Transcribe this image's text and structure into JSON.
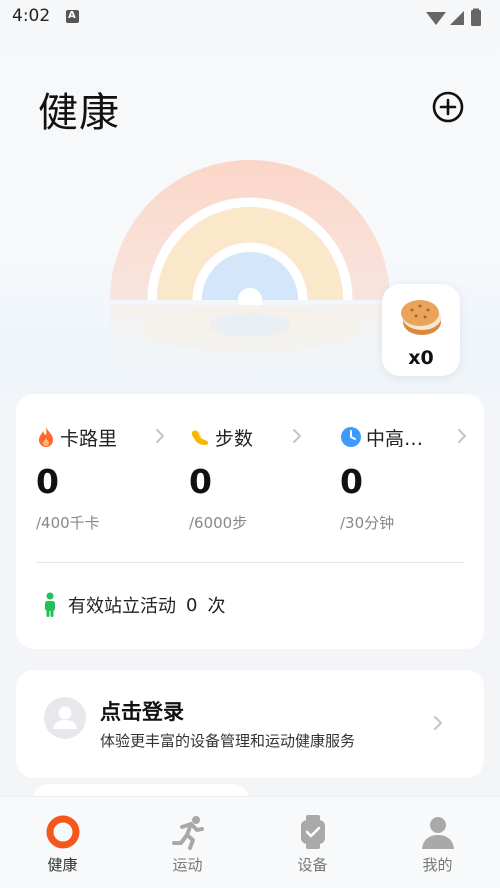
{
  "status_bar": {
    "time": "4:02",
    "notification_letter": "A"
  },
  "header": {
    "title": "健康"
  },
  "badge": {
    "count": "x0"
  },
  "stats": [
    {
      "label": "卡路里",
      "value": "0",
      "goal": "/400千卡",
      "icon": "flame-icon",
      "color": "#ff6a2b"
    },
    {
      "label": "步数",
      "value": "0",
      "goal": "/6000步",
      "icon": "shoe-icon",
      "color": "#f5b800"
    },
    {
      "label": "中高…",
      "value": "0",
      "goal": "/30分钟",
      "icon": "clock-icon",
      "color": "#3d9bff"
    }
  ],
  "stand": {
    "label": "有效站立活动",
    "count": "0",
    "unit": "次"
  },
  "login": {
    "title": "点击登录",
    "subtitle": "体验更丰富的设备管理和运动健康服务"
  },
  "nav": [
    {
      "label": "健康",
      "icon": "health-ring-icon",
      "active": true
    },
    {
      "label": "运动",
      "icon": "running-icon",
      "active": false
    },
    {
      "label": "设备",
      "icon": "watch-icon",
      "active": false
    },
    {
      "label": "我的",
      "icon": "person-icon",
      "active": false
    }
  ],
  "colors": {
    "accent": "#f4571c",
    "rainbow_outer": "#fbd8cc",
    "rainbow_middle": "#fbe8c8",
    "rainbow_inner": "#d6e9fb",
    "stand_icon": "#22c05a"
  }
}
